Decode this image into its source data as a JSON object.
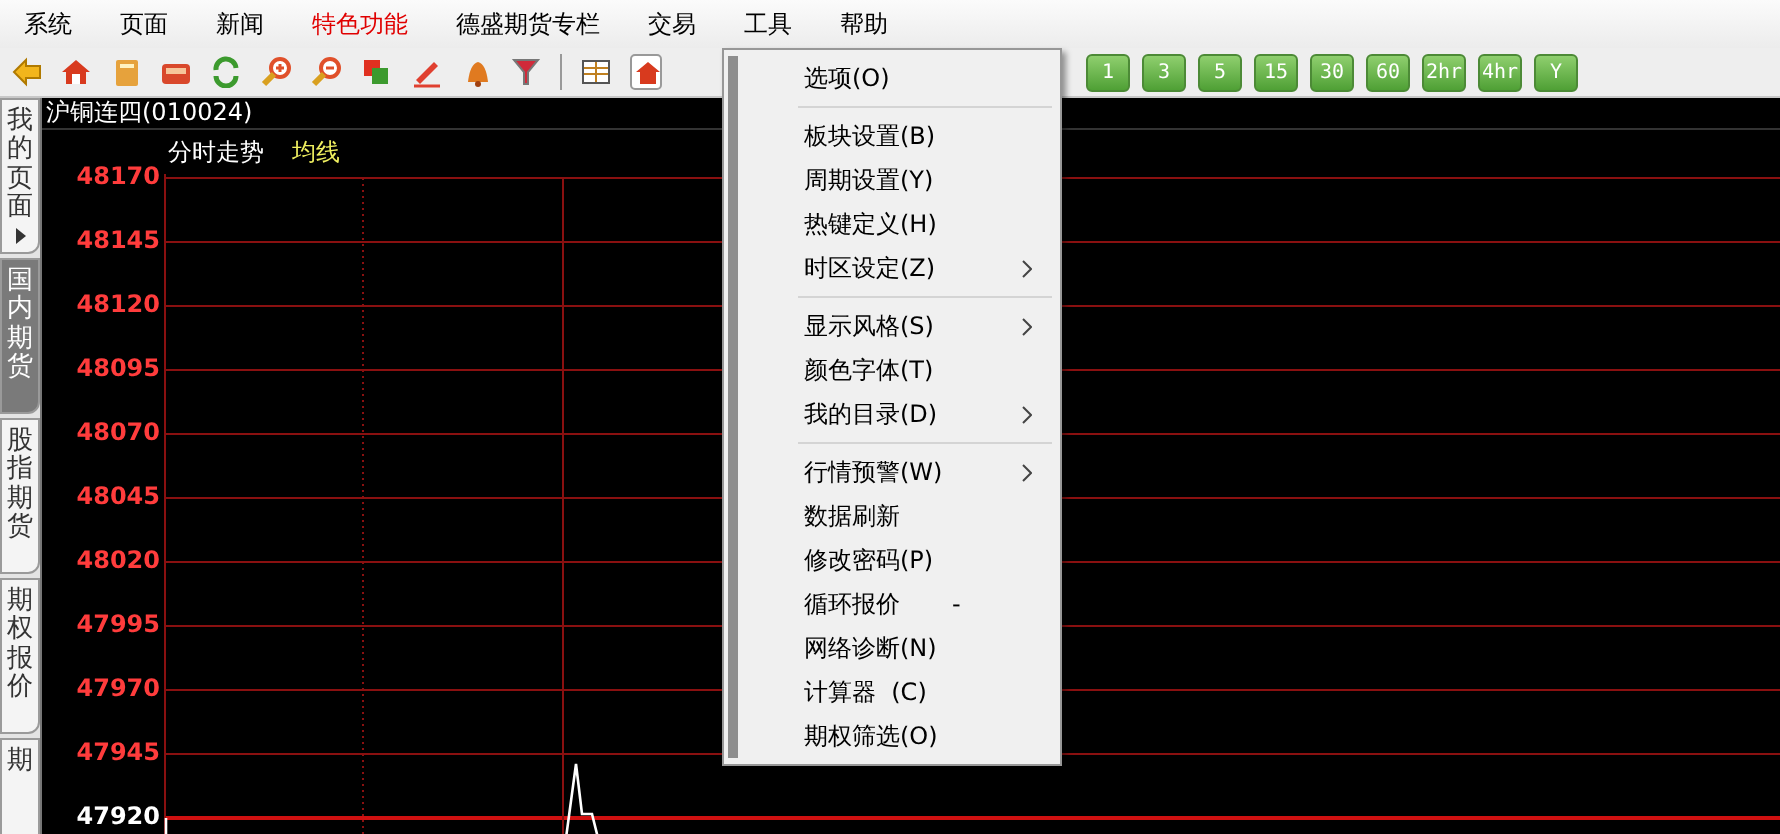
{
  "menu_bar": [
    {
      "label": "系统",
      "color": "#000000"
    },
    {
      "label": "页面",
      "color": "#000000"
    },
    {
      "label": "新闻",
      "color": "#000000"
    },
    {
      "label": "特色功能",
      "color": "#e00000"
    },
    {
      "label": "德盛期货专栏",
      "color": "#000000"
    },
    {
      "label": "交易",
      "color": "#000000"
    },
    {
      "label": "工具",
      "color": "#000000"
    },
    {
      "label": "帮助",
      "color": "#000000"
    }
  ],
  "period_buttons": [
    {
      "label": "1"
    },
    {
      "label": "3"
    },
    {
      "label": "5"
    },
    {
      "label": "15"
    },
    {
      "label": "30"
    },
    {
      "label": "60"
    },
    {
      "label": "2hr"
    },
    {
      "label": "4hr"
    },
    {
      "label": "Y"
    }
  ],
  "side_tabs": [
    {
      "label": "我的页面",
      "selected": false,
      "has_arrow": true
    },
    {
      "label": "国内期货",
      "selected": true,
      "has_arrow": false
    },
    {
      "label": "股指期货",
      "selected": false,
      "has_arrow": false
    },
    {
      "label": "期权报价",
      "selected": false,
      "has_arrow": false
    },
    {
      "label": "期",
      "selected": false,
      "has_arrow": false
    }
  ],
  "chart": {
    "title": "沪铜连四(010024)",
    "view_label": "分时走势",
    "average_label": "均线",
    "y_labels": [
      {
        "text": "48170",
        "color": "#ff3c3c"
      },
      {
        "text": "48145",
        "color": "#ff3c3c"
      },
      {
        "text": "48120",
        "color": "#ff3c3c"
      },
      {
        "text": "48095",
        "color": "#ff3c3c"
      },
      {
        "text": "48070",
        "color": "#ff3c3c"
      },
      {
        "text": "48045",
        "color": "#ff3c3c"
      },
      {
        "text": "48020",
        "color": "#ff3c3c"
      },
      {
        "text": "47995",
        "color": "#ff3c3c"
      },
      {
        "text": "47970",
        "color": "#ff3c3c"
      },
      {
        "text": "47945",
        "color": "#ff3c3c"
      },
      {
        "text": "47920",
        "color": "#ffffff"
      }
    ]
  },
  "context_menu": [
    {
      "kind": "item",
      "label": "选项(O)",
      "has_submenu": false
    },
    {
      "kind": "separator"
    },
    {
      "kind": "item",
      "label": "板块设置(B)",
      "has_submenu": false
    },
    {
      "kind": "item",
      "label": "周期设置(Y)",
      "has_submenu": false
    },
    {
      "kind": "item",
      "label": "热键定义(H)",
      "has_submenu": false
    },
    {
      "kind": "item",
      "label": "时区设定(Z)",
      "has_submenu": true
    },
    {
      "kind": "separator"
    },
    {
      "kind": "item",
      "label": "显示风格(S)",
      "has_submenu": true
    },
    {
      "kind": "item",
      "label": "颜色字体(T)",
      "has_submenu": false
    },
    {
      "kind": "item",
      "label": "我的目录(D)",
      "has_submenu": true
    },
    {
      "kind": "separator"
    },
    {
      "kind": "item",
      "label": "行情预警(W)",
      "has_submenu": true
    },
    {
      "kind": "item",
      "label": "数据刷新",
      "has_submenu": false
    },
    {
      "kind": "item",
      "label": "修改密码(P)",
      "has_submenu": false
    },
    {
      "kind": "item",
      "label": "循环报价",
      "shortcut": "-",
      "has_submenu": false
    },
    {
      "kind": "item",
      "label": "网络诊断(N)",
      "has_submenu": false
    },
    {
      "kind": "item",
      "label": "计算器  (C)",
      "has_submenu": false
    },
    {
      "kind": "item",
      "label": "期权筛选(O)",
      "has_submenu": false
    }
  ]
}
